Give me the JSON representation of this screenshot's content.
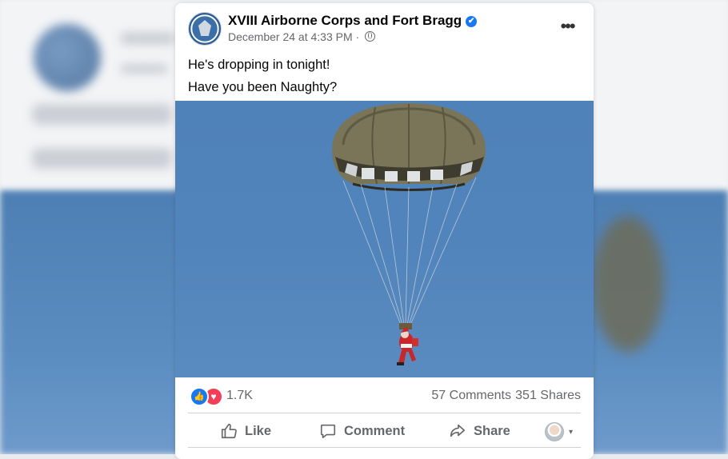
{
  "post": {
    "page_name": "XVIII Airborne Corps and Fort Bragg",
    "verified_glyph": "✔",
    "date": "December 24 at 4:33 PM",
    "separator": "·",
    "more_glyph": "•••",
    "text_lines": [
      "He's dropping in tonight!",
      "Have you been Naughty?"
    ],
    "photo_description_icon": "parachuting-santa"
  },
  "engagement": {
    "reaction_count": "1.7K",
    "comments": "57 Comments",
    "shares": "351 Shares",
    "like_glyph": "👍",
    "love_glyph": "♥"
  },
  "actions": {
    "like": "Like",
    "comment": "Comment",
    "share": "Share",
    "caret": "▾"
  },
  "colors": {
    "accent": "#1877f2",
    "love": "#f33e58",
    "sky": "#5184bb",
    "secondary_text": "#65676b"
  }
}
